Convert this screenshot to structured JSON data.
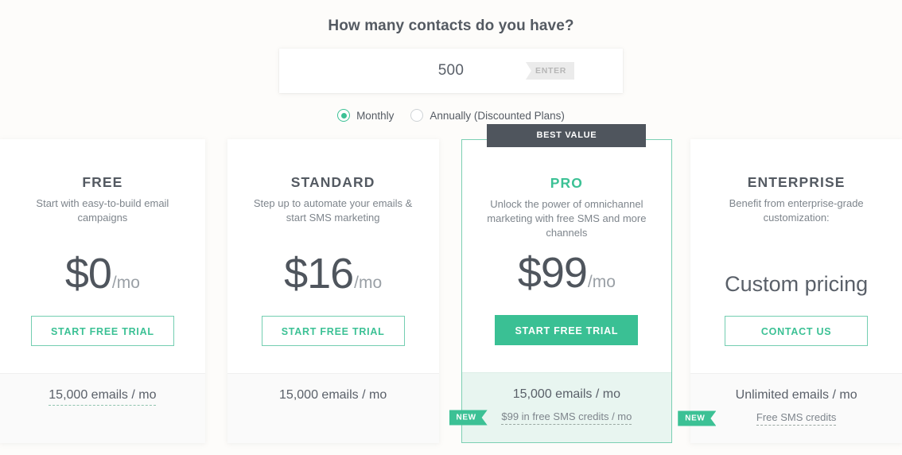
{
  "header": {
    "headline": "How many contacts do you have?"
  },
  "contacts_input": {
    "value": "500",
    "placeholder": "500",
    "enter_label": "ENTER"
  },
  "billing": {
    "options": [
      {
        "label": "Monthly",
        "selected": true
      },
      {
        "label": "Annually (Discounted Plans)",
        "selected": false
      }
    ]
  },
  "badges": {
    "best_value": "BEST VALUE",
    "new": "NEW"
  },
  "colors": {
    "accent_green": "#3cc195",
    "button_green": "#3ac094",
    "dark_slate": "#4f555d",
    "page_background": "#fdfcfa",
    "foot_gray": "#fafafa",
    "foot_mint": "#e8f5f0"
  },
  "plans": [
    {
      "name": "FREE",
      "description": "Start with easy-to-build email campaigns",
      "price_main": "$0",
      "price_suffix": "/mo",
      "cta_label": "START FREE TRIAL",
      "cta_style": "outline",
      "featured": false,
      "features": {
        "primary": "15,000 emails / mo",
        "primary_dotted": true,
        "secondary": null,
        "secondary_new": false
      }
    },
    {
      "name": "STANDARD",
      "description": "Step up to automate your emails & start SMS marketing",
      "price_main": "$16",
      "price_suffix": "/mo",
      "cta_label": "START FREE TRIAL",
      "cta_style": "outline",
      "featured": false,
      "features": {
        "primary": "15,000 emails / mo",
        "primary_dotted": false,
        "secondary": null,
        "secondary_new": false
      }
    },
    {
      "name": "PRO",
      "description": "Unlock the power of omnichannel marketing with free SMS and more channels",
      "price_main": "$99",
      "price_suffix": "/mo",
      "cta_label": "START FREE TRIAL",
      "cta_style": "solid",
      "featured": true,
      "features": {
        "primary": "15,000 emails / mo",
        "primary_dotted": false,
        "secondary": "$99 in free SMS credits / mo",
        "secondary_new": true
      }
    },
    {
      "name": "ENTERPRISE",
      "description": "Benefit from enterprise-grade customization:",
      "price_custom": "Custom pricing",
      "cta_label": "CONTACT US",
      "cta_style": "outline",
      "featured": false,
      "features": {
        "primary": "Unlimited emails / mo",
        "primary_dotted": false,
        "secondary": "Free SMS credits",
        "secondary_new": true
      }
    }
  ]
}
